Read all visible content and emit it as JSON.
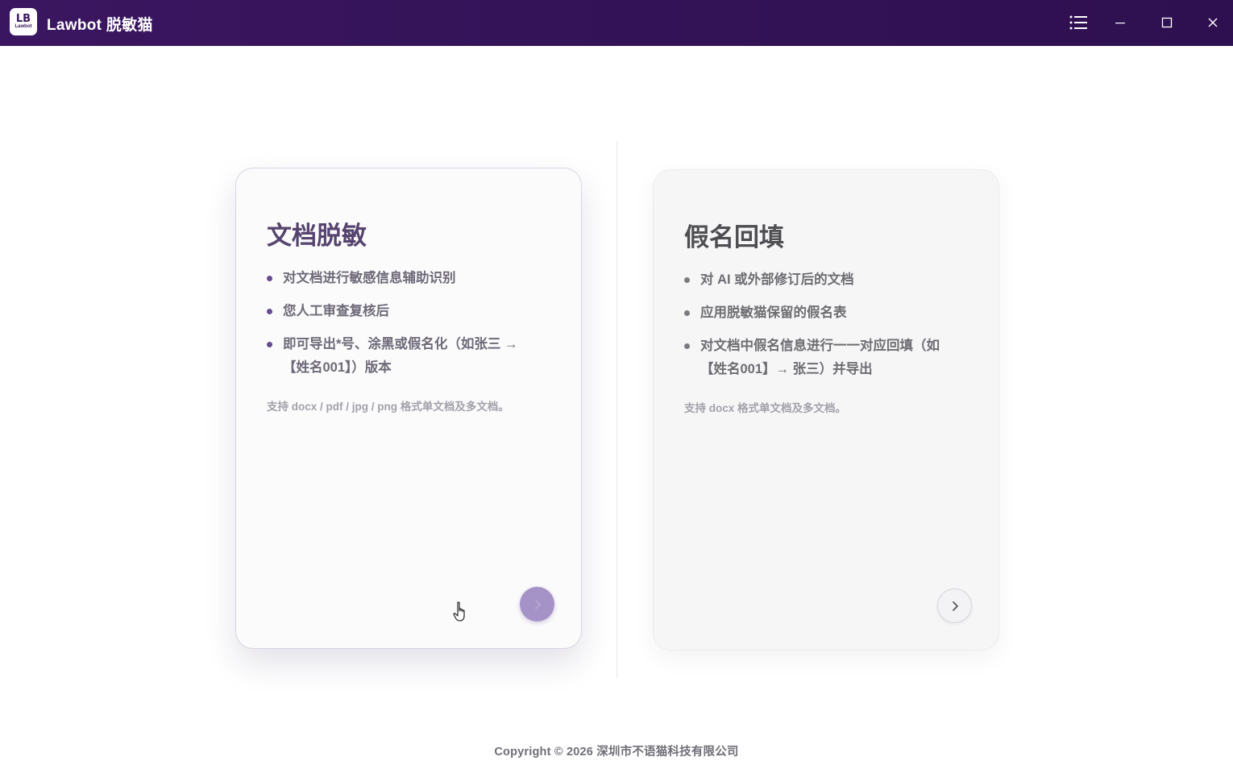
{
  "titlebar": {
    "logo_mark": "LB",
    "logo_word": "Lawbot",
    "title": "Lawbot 脱敏猫",
    "bg_color": "#3a1660"
  },
  "cards": [
    {
      "title": "文档脱敏",
      "bullets": [
        "对文档进行敏感信息辅助识别",
        "您人工审查复核后",
        "即可导出*号、涂黑或假名化（如张三 → 【姓名001】）版本"
      ],
      "note": "支持 docx / pdf / jpg / png 格式单文档及多文档。",
      "accent": "#6a4a93",
      "button_icon": "chevron-right-icon"
    },
    {
      "title": "假名回填",
      "bullets": [
        "对 AI 或外部修订后的文档",
        "应用脱敏猫保留的假名表",
        "对文档中假名信息进行一一对应回填（如【姓名001】→ 张三）并导出"
      ],
      "note": "支持 docx 格式单文档及多文档。",
      "accent": "#7a7a80",
      "button_icon": "chevron-right-icon"
    }
  ],
  "footer": {
    "copyright": "Copyright © 2026 深圳市不语猫科技有限公司"
  }
}
